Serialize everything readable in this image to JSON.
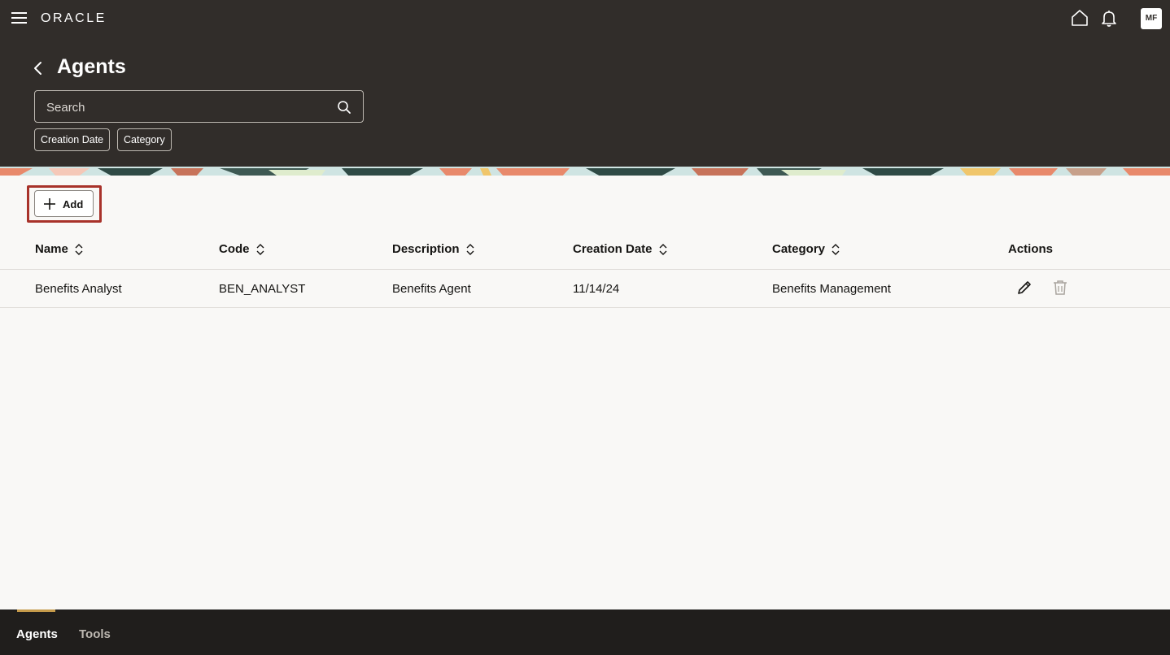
{
  "header": {
    "logo": "ORACLE",
    "avatar_initials": "MF",
    "title": "Agents",
    "search_placeholder": "Search",
    "filters": [
      "Creation Date",
      "Category"
    ]
  },
  "toolbar": {
    "add_label": "Add",
    "highlight_color": "#a8322a"
  },
  "table": {
    "columns": [
      "Name",
      "Code",
      "Description",
      "Creation Date",
      "Category",
      "Actions"
    ],
    "rows": [
      {
        "name": "Benefits Analyst",
        "code": "BEN_ANALYST",
        "description": "Benefits Agent",
        "creation_date": "11/14/24",
        "category": "Benefits Management",
        "actions": [
          "edit-icon",
          "trash-icon"
        ]
      }
    ]
  },
  "footer": {
    "tabs": [
      {
        "label": "Agents",
        "active": true
      },
      {
        "label": "Tools",
        "active": false
      }
    ]
  },
  "icons": [
    "menu-icon",
    "home-icon",
    "bell-icon",
    "back-arrow-icon",
    "search-icon",
    "plus-icon",
    "sort-icon",
    "edit-icon",
    "trash-icon"
  ],
  "colors": {
    "header_bg": "#312d2a",
    "footer_bg": "#201e1c",
    "page_bg": "#f9f8f6",
    "active_tab_indicator": "#c59a4a"
  }
}
